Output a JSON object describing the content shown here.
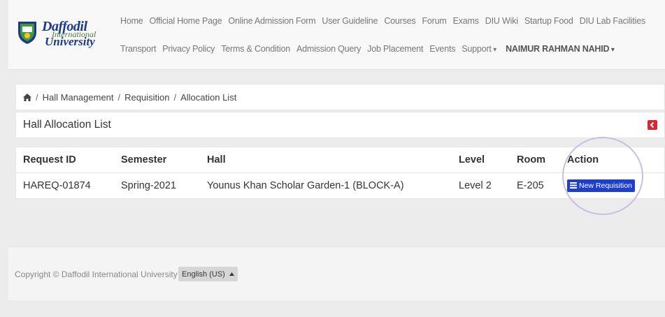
{
  "brand": {
    "line1": "Daffodil",
    "line2": "International",
    "line3": "University"
  },
  "nav": {
    "row1": [
      "Home",
      "Official Home Page",
      "Online Admission Form",
      "User Guideline",
      "Courses",
      "Forum",
      "Exams",
      "DIU Wiki",
      "Startup Food",
      "DIU Lab Facilities"
    ],
    "row2": [
      "Transport",
      "Privacy Policy",
      "Terms & Condition",
      "Admission Query",
      "Job Placement",
      "Events"
    ],
    "support": "Support",
    "user": "NAIMUR RAHMAN NAHID"
  },
  "breadcrumb": {
    "items": [
      "Hall Management",
      "Requisition",
      "Allocation List"
    ],
    "separator": "/"
  },
  "page": {
    "title": "Hall Allocation List"
  },
  "table": {
    "headers": [
      "Request ID",
      "Semester",
      "Hall",
      "Level",
      "Room",
      "Action"
    ],
    "rows": [
      {
        "request_id": "HAREQ-01874",
        "semester": "Spring-2021",
        "hall": "Younus Khan Scholar Garden-1 (BLOCK-A)",
        "level": "Level 2",
        "room": "E-205",
        "action": "New Requisition"
      }
    ]
  },
  "footer": {
    "copyright": "Copyright © Daffodil International University",
    "language": "English (US)"
  },
  "colors": {
    "primary_button": "#1d3fcf",
    "back_button": "#d9272e",
    "brand_blue": "#1d3a8a",
    "highlight_circle": "#c6bfe4"
  },
  "icons": {
    "home": "home-icon",
    "back": "arrow-left-icon",
    "list": "list-icon",
    "caret_up": "caret-up-icon"
  }
}
